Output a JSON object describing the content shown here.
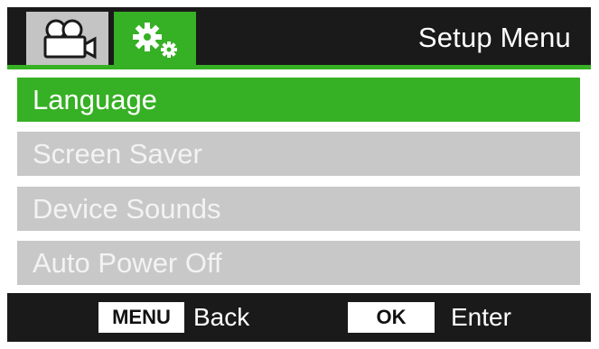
{
  "header": {
    "title": "Setup Menu",
    "tabs": [
      {
        "icon": "video-camera-icon",
        "active": false
      },
      {
        "icon": "gears-icon",
        "active": true
      }
    ]
  },
  "menu": {
    "items": [
      {
        "label": "Language",
        "selected": true
      },
      {
        "label": "Screen Saver",
        "selected": false
      },
      {
        "label": "Device Sounds",
        "selected": false
      },
      {
        "label": "Auto Power Off",
        "selected": false
      }
    ]
  },
  "footer": {
    "menu_key": "MENU",
    "menu_action": "Back",
    "ok_key": "OK",
    "ok_action": "Enter"
  },
  "colors": {
    "accent": "#36b024",
    "bar": "#1a1a1a",
    "inactive_item": "#c8c8c8",
    "inactive_tab": "#c4c4c4"
  }
}
